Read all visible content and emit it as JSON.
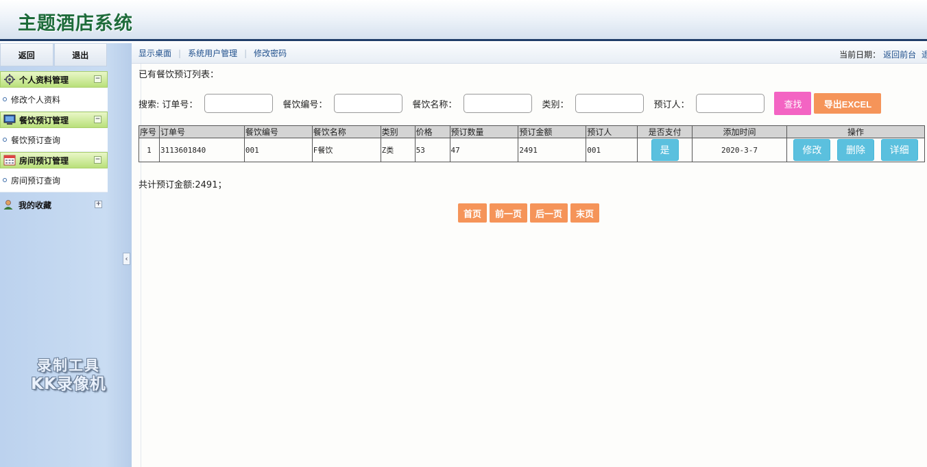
{
  "header": {
    "title": "主题酒店系统"
  },
  "sidebar": {
    "back_label": "返回",
    "logout_label": "退出",
    "groups": [
      {
        "label": "个人资料管理",
        "icon": "gear-icon",
        "items": [
          {
            "label": "修改个人资料"
          }
        ]
      },
      {
        "label": "餐饮预订管理",
        "icon": "monitor-icon",
        "items": [
          {
            "label": "餐饮预订查询"
          }
        ]
      },
      {
        "label": "房间预订管理",
        "icon": "calendar-icon",
        "items": [
          {
            "label": "房间预订查询"
          }
        ]
      }
    ],
    "favorites_label": "我的收藏",
    "watermark_line1": "录制工具",
    "watermark_line2": "KK录像机"
  },
  "topnav": {
    "links": [
      "显示桌面",
      "系统用户管理",
      "修改密码"
    ],
    "date_label": "当前日期：",
    "back_front_label": "返回前台",
    "exit_label": "退"
  },
  "main": {
    "list_title": "已有餐饮预订列表：",
    "search": {
      "prefix": "搜索:",
      "order_no_label": "订单号：",
      "food_no_label": "餐饮编号：",
      "food_name_label": "餐饮名称：",
      "category_label": "类别：",
      "booker_label": "预订人：",
      "search_button": "查找",
      "export_button": "导出EXCEL"
    },
    "table": {
      "headers": [
        "序号",
        "订单号",
        "餐饮编号",
        "餐饮名称",
        "类别",
        "价格",
        "预订数量",
        "预订金额",
        "预订人",
        "是否支付",
        "添加时间",
        "操作"
      ],
      "rows": [
        {
          "index": "1",
          "order_no": "3113601840",
          "food_no": "001",
          "food_name": "F餐饮",
          "category": "Z类",
          "price": "53",
          "quantity": "47",
          "amount": "2491",
          "booker": "001",
          "paid": "是",
          "added_time": "2020-3-7",
          "actions": [
            "修改",
            "删除",
            "详细"
          ]
        }
      ]
    },
    "total": "共计预订金额:2491；",
    "pager": [
      "首页",
      "前一页",
      "后一页",
      "末页"
    ]
  },
  "colors": {
    "header_border": "#1f3d68",
    "title_green": "#1d6b3a",
    "menu_green": "#b9e07a",
    "search_pink": "#f364c3",
    "accent_orange": "#f59459",
    "info_blue": "#5bc0de",
    "link_blue": "#1f4f8c"
  }
}
